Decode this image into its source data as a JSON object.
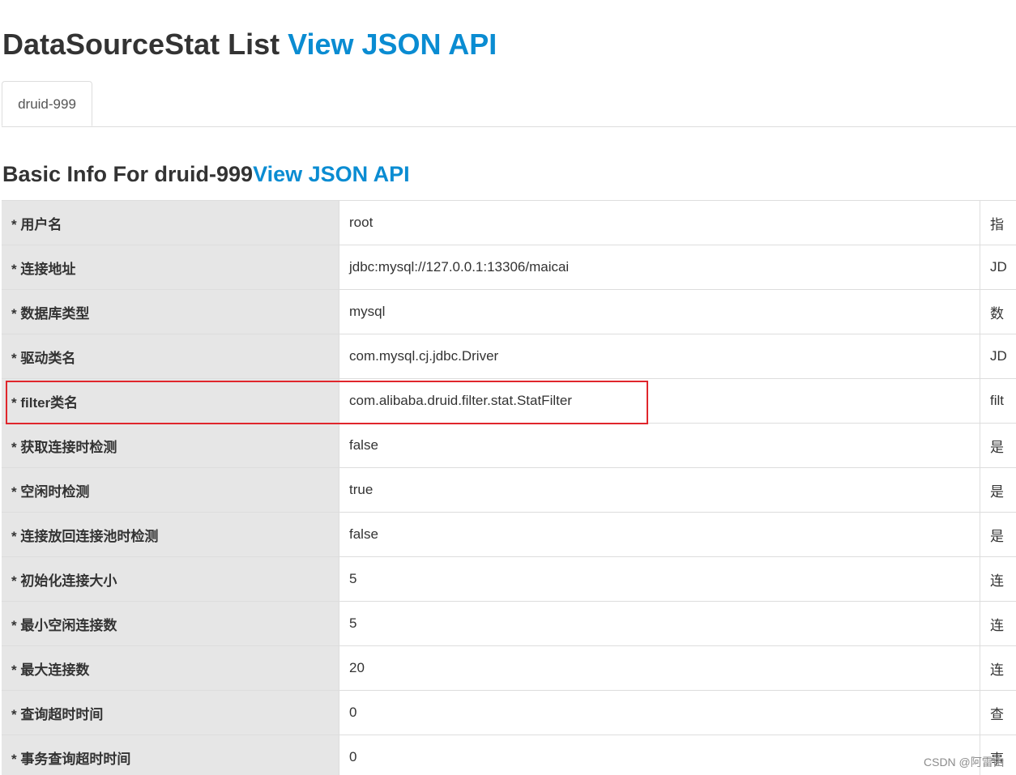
{
  "header": {
    "title": "DataSourceStat List",
    "json_link": "View JSON API"
  },
  "tabs": [
    {
      "label": "druid-999",
      "active": true
    }
  ],
  "section": {
    "title": "Basic Info For druid-999",
    "json_link": "View JSON API"
  },
  "rows": [
    {
      "key": "* 用户名",
      "value": "root",
      "desc": "指"
    },
    {
      "key": "* 连接地址",
      "value": "jdbc:mysql://127.0.0.1:13306/maicai",
      "desc": "JD"
    },
    {
      "key": "* 数据库类型",
      "value": "mysql",
      "desc": "数"
    },
    {
      "key": "* 驱动类名",
      "value": "com.mysql.cj.jdbc.Driver",
      "desc": "JD"
    },
    {
      "key": "* filter类名",
      "value": "com.alibaba.druid.filter.stat.StatFilter",
      "desc": "filt",
      "highlighted": true
    },
    {
      "key": "* 获取连接时检测",
      "value": "false",
      "desc": "是"
    },
    {
      "key": "* 空闲时检测",
      "value": "true",
      "desc": "是"
    },
    {
      "key": "* 连接放回连接池时检测",
      "value": "false",
      "desc": "是"
    },
    {
      "key": "* 初始化连接大小",
      "value": "5",
      "desc": "连"
    },
    {
      "key": "* 最小空闲连接数",
      "value": "5",
      "desc": "连"
    },
    {
      "key": "* 最大连接数",
      "value": "20",
      "desc": "连"
    },
    {
      "key": "* 查询超时时间",
      "value": "0",
      "desc": "查"
    },
    {
      "key": "* 事务查询超时时间",
      "value": "0",
      "desc": "事"
    }
  ],
  "colors": {
    "link": "#0A8CD2",
    "label_bg": "#e6e6e6",
    "highlight_border": "#e0262c"
  },
  "watermark": "CSDN @阿雷由"
}
